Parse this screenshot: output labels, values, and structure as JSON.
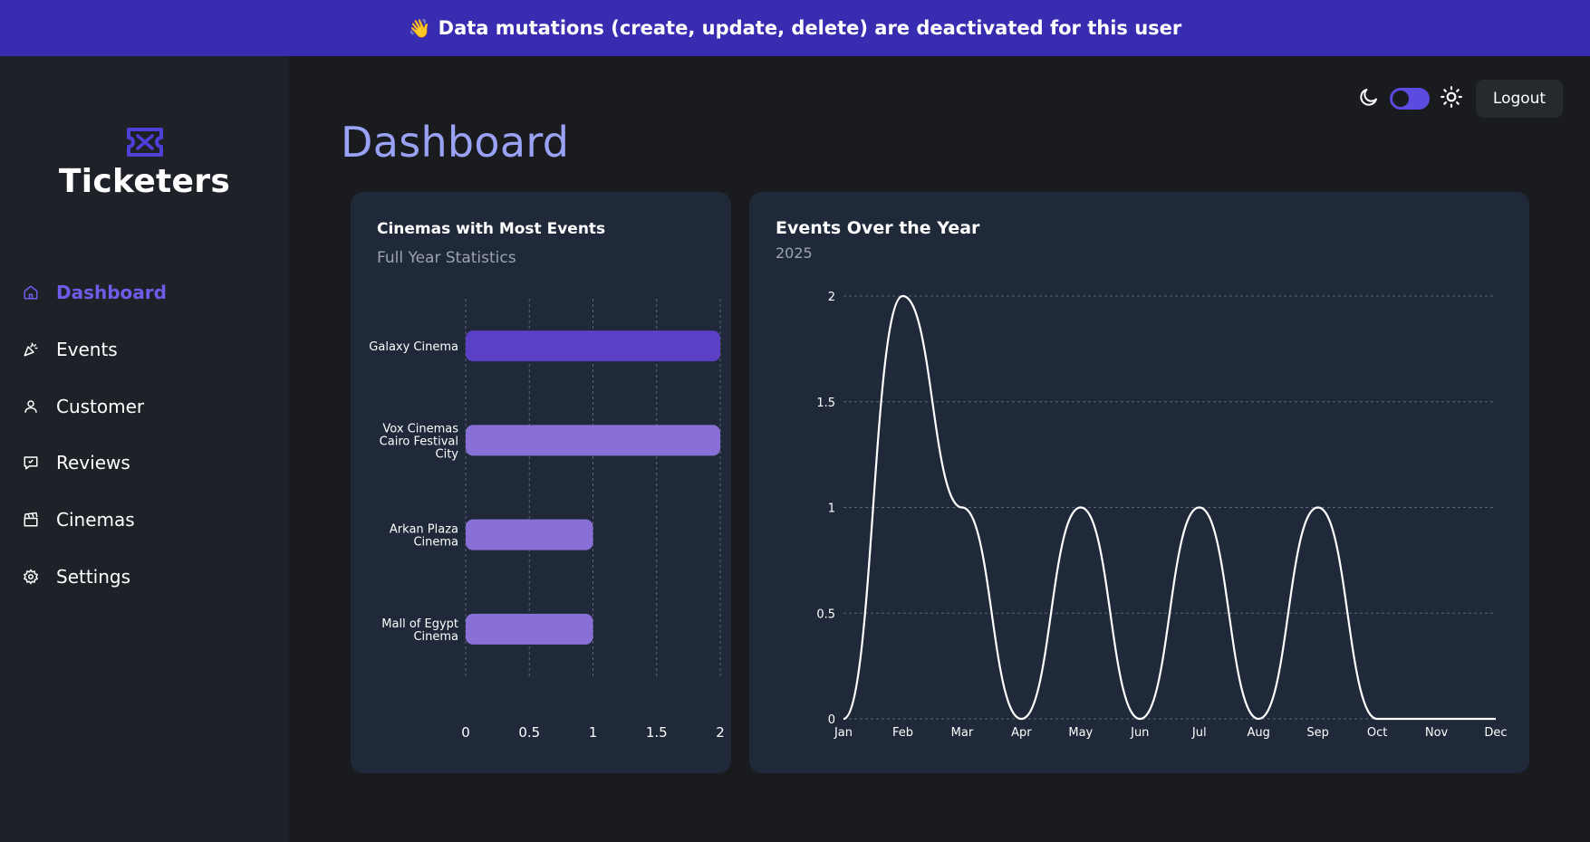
{
  "banner": {
    "emoji": "👋",
    "text": "Data mutations (create, update, delete) are deactivated for this user"
  },
  "brand": {
    "name": "Ticketers",
    "accent": "#4f3fd9"
  },
  "sidebar": {
    "items": [
      {
        "label": "Dashboard",
        "icon": "home-icon",
        "active": true
      },
      {
        "label": "Events",
        "icon": "party-popper-icon",
        "active": false
      },
      {
        "label": "Customer",
        "icon": "user-icon",
        "active": false
      },
      {
        "label": "Reviews",
        "icon": "review-icon",
        "active": false
      },
      {
        "label": "Cinemas",
        "icon": "clapperboard-icon",
        "active": false
      },
      {
        "label": "Settings",
        "icon": "gear-icon",
        "active": false
      }
    ]
  },
  "topbar": {
    "theme": "dark",
    "toggle_on": true,
    "logout_label": "Logout"
  },
  "page": {
    "title": "Dashboard"
  },
  "colors": {
    "banner": "#382cb0",
    "background": "#1a1b1f",
    "sidebar": "#1e2228",
    "card": "#1f2939",
    "title": "#9aa2f5",
    "active_nav": "#6d5ce8",
    "bar_primary": "#5b3fc4",
    "bar_secondary": "#8870d6",
    "line": "#ffffff",
    "toggle": "#5b4be0"
  },
  "cards": {
    "cinemas": {
      "title": "Cinemas with Most Events",
      "subtitle": "Full Year Statistics"
    },
    "events": {
      "title": "Events Over the Year",
      "subtitle": "2025"
    }
  },
  "chart_data": [
    {
      "type": "bar",
      "orientation": "horizontal",
      "title": "Cinemas with Most Events",
      "subtitle": "Full Year Statistics",
      "categories": [
        [
          "Galaxy Cinema"
        ],
        [
          "Vox Cinemas",
          "Cairo Festival",
          "City"
        ],
        [
          "Arkan Plaza",
          "Cinema"
        ],
        [
          "Mall of Egypt",
          "Cinema"
        ]
      ],
      "values": [
        2,
        2,
        1,
        1
      ],
      "xlim": [
        0,
        2
      ],
      "xticks": [
        "0",
        "0.5",
        "1",
        "1.5",
        "2"
      ],
      "grid": "vertical dashed"
    },
    {
      "type": "line",
      "title": "Events Over the Year",
      "subtitle": "2025",
      "x": [
        "Jan",
        "Feb",
        "Mar",
        "Apr",
        "May",
        "Jun",
        "Jul",
        "Aug",
        "Sep",
        "Oct",
        "Nov",
        "Dec"
      ],
      "values": [
        0,
        2,
        1,
        0,
        1,
        0,
        1,
        0,
        1,
        0,
        0,
        0
      ],
      "ylim": [
        0,
        2
      ],
      "yticks": [
        "0",
        "0.5",
        "1",
        "1.5",
        "2"
      ],
      "grid": "horizontal dashed",
      "curve": "smooth"
    }
  ]
}
